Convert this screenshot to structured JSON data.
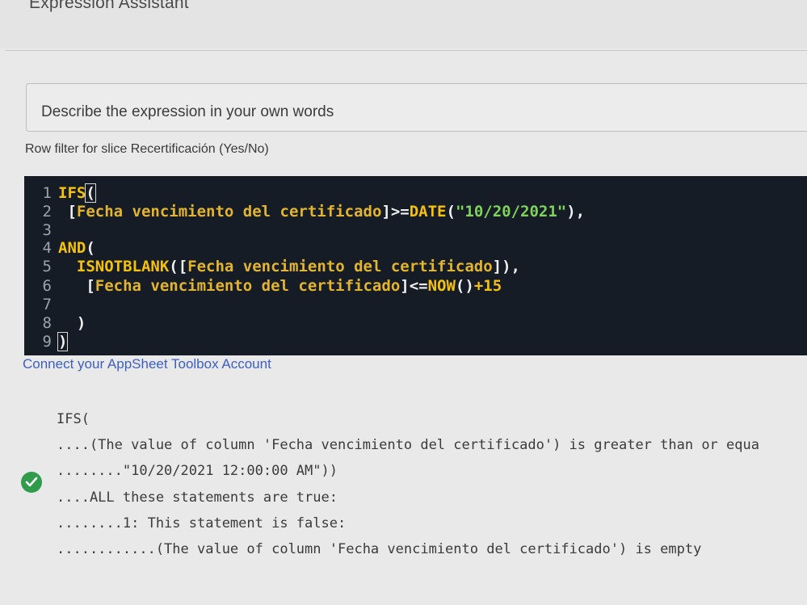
{
  "header": {
    "title": "Expression Assistant"
  },
  "describe": {
    "placeholder": "Describe the expression in your own words"
  },
  "row_filter_label": "Row filter for slice Recertificación (Yes/No)",
  "editor": {
    "lines": [
      {
        "n": "1",
        "tokens": [
          {
            "t": "IFS",
            "c": "kw"
          },
          {
            "t": "(",
            "c": "punc",
            "hl": true
          }
        ]
      },
      {
        "n": "2",
        "tokens": [
          {
            "t": " [",
            "c": "punc"
          },
          {
            "t": "Fecha vencimiento del certificado",
            "c": "fld"
          },
          {
            "t": "]>=",
            "c": "punc"
          },
          {
            "t": "DATE",
            "c": "kw"
          },
          {
            "t": "(",
            "c": "punc"
          },
          {
            "t": "\"10/20/2021\"",
            "c": "str"
          },
          {
            "t": "),",
            "c": "punc"
          }
        ]
      },
      {
        "n": "3",
        "tokens": []
      },
      {
        "n": "4",
        "tokens": [
          {
            "t": "AND",
            "c": "kw"
          },
          {
            "t": "(",
            "c": "punc"
          }
        ]
      },
      {
        "n": "5",
        "tokens": [
          {
            "t": "  ISNOTBLANK",
            "c": "kw"
          },
          {
            "t": "([",
            "c": "punc"
          },
          {
            "t": "Fecha vencimiento del certificado",
            "c": "fld"
          },
          {
            "t": "]),",
            "c": "punc"
          }
        ]
      },
      {
        "n": "6",
        "tokens": [
          {
            "t": "   [",
            "c": "punc"
          },
          {
            "t": "Fecha vencimiento del certificado",
            "c": "fld"
          },
          {
            "t": "]<=",
            "c": "punc"
          },
          {
            "t": "NOW",
            "c": "kw"
          },
          {
            "t": "()",
            "c": "punc"
          },
          {
            "t": "+15",
            "c": "kw"
          }
        ]
      },
      {
        "n": "7",
        "tokens": []
      },
      {
        "n": "8",
        "tokens": [
          {
            "t": "  )",
            "c": "punc"
          }
        ]
      },
      {
        "n": "9",
        "tokens": [
          {
            "t": ")",
            "c": "punc",
            "hl": true
          }
        ]
      }
    ]
  },
  "connect_link": "Connect your AppSheet Toolbox Account",
  "result": {
    "icon": "check-circle-icon",
    "lines": [
      "IFS(",
      "....(The value of column 'Fecha vencimiento del certificado') is greater than or equa",
      "........\"10/20/2021 12:00:00 AM\"))",
      "....ALL these statements are true:",
      "........1: This statement is false:",
      "............(The value of column 'Fecha vencimiento del certificado') is empty"
    ]
  },
  "colors": {
    "editor_bg": "#161c26",
    "keyword": "#f4c20d",
    "string": "#7fd35c",
    "link": "#3d5fc0",
    "check": "#2e9c4a"
  }
}
